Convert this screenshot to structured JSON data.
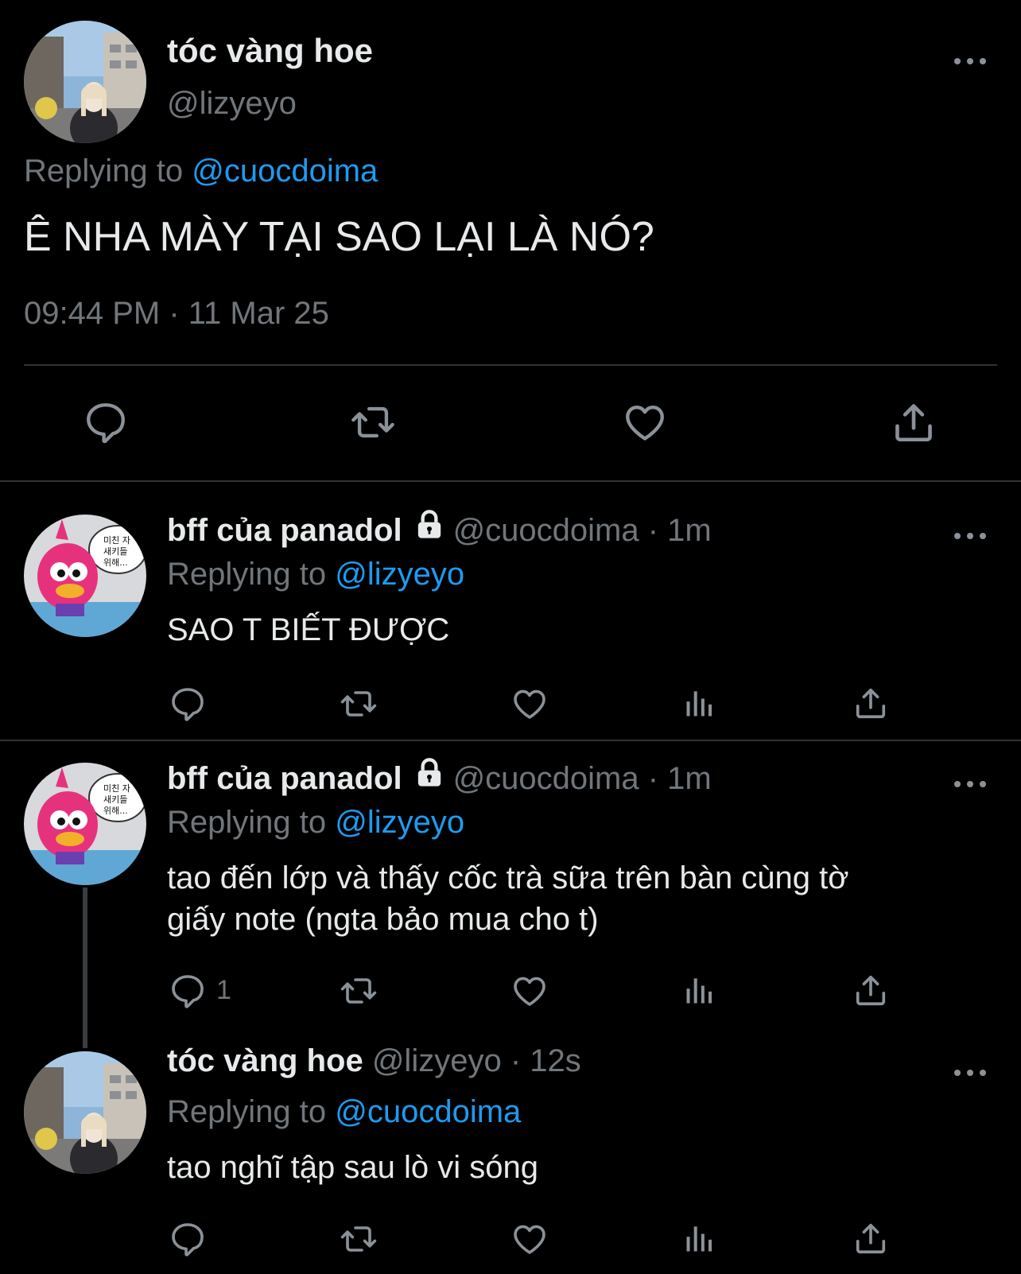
{
  "main_tweet": {
    "display_name": "tóc vàng hoe",
    "handle": "@lizyeyo",
    "replying_prefix": "Replying to",
    "replying_to": "@cuocdoima",
    "text": "Ê NHA MÀY TẠI SAO LẠI LÀ NÓ?",
    "timestamp": "09:44 PM · 11 Mar 25",
    "actions": [
      "reply-icon",
      "retweet-icon",
      "like-icon",
      "share-icon"
    ]
  },
  "replies": [
    {
      "display_name": "bff của panadol",
      "handle": "@cuocdoima",
      "time": "· 1m",
      "replying_prefix": "Replying to",
      "replying_to": "@lizyeyo",
      "text": "SAO T BIẾT ĐƯỢC",
      "reply_count": "",
      "avatar_bubble": [
        "미친 자",
        "새키들",
        "위해..."
      ]
    },
    {
      "display_name": "bff của panadol",
      "handle": "@cuocdoima",
      "time": "· 1m",
      "replying_prefix": "Replying to",
      "replying_to": "@lizyeyo",
      "text_line1": "tao đến lớp và thấy cốc trà sữa trên bàn cùng tờ",
      "text_line2": "giấy note (ngta bảo mua cho t)",
      "reply_count": "1",
      "avatar_bubble": [
        "미친 자",
        "새키들",
        "위해..."
      ]
    },
    {
      "display_name": "tóc vàng hoe",
      "handle": "@lizyeyo",
      "time": "· 12s",
      "replying_prefix": "Replying to",
      "replying_to": "@cuocdoima",
      "text": "tao nghĩ tập sau lò vi sóng",
      "reply_count": ""
    }
  ],
  "colors": {
    "background": "#000000",
    "text": "#e7e9ea",
    "muted": "#71767b",
    "link": "#1d9bf0",
    "divider": "#2f3336"
  }
}
